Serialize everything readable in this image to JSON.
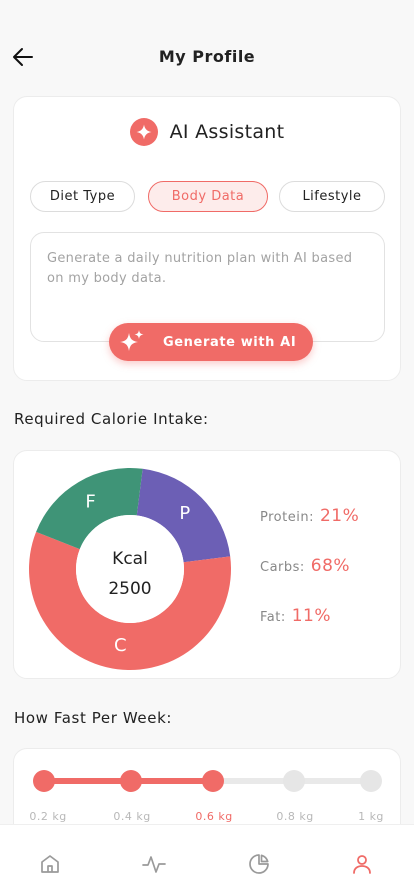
{
  "header": {
    "title": "My Profile",
    "back_icon": "arrow-left-icon"
  },
  "ai_assistant": {
    "title": "AI Assistant",
    "icon": "sparkle-icon",
    "tabs": [
      {
        "label": "Diet Type",
        "active": false
      },
      {
        "label": "Body Data",
        "active": true
      },
      {
        "label": "Lifestyle",
        "active": false
      }
    ],
    "prompt_text": "Generate a daily nutrition plan with AI based on my body data.",
    "generate_label": "Generate with AI"
  },
  "calorie": {
    "section_title": "Required Calorie Intake:",
    "unit": "Kcal",
    "value": "2500",
    "macros": [
      {
        "name": "Protein:",
        "percent": "21%",
        "letter": "P",
        "fraction": 0.21,
        "color": "#6c5fb5"
      },
      {
        "name": "Carbs:",
        "percent": "68%",
        "letter": "C",
        "fraction": 0.58,
        "color": "#f06b67"
      },
      {
        "name": "Fat:",
        "percent": "11%",
        "letter": "F",
        "fraction": 0.21,
        "color": "#3f9477"
      }
    ]
  },
  "speed": {
    "section_title": "How Fast Per Week:",
    "options": [
      "0.2 kg",
      "0.4 kg",
      "0.6 kg",
      "0.8 kg",
      "1 kg"
    ],
    "selected_index": 2,
    "accent_color": "#f06b67"
  },
  "tabbar": {
    "items": [
      {
        "icon": "home-icon",
        "active": false
      },
      {
        "icon": "activity-icon",
        "active": false
      },
      {
        "icon": "pie-chart-icon",
        "active": false
      },
      {
        "icon": "user-icon",
        "active": true
      }
    ]
  }
}
